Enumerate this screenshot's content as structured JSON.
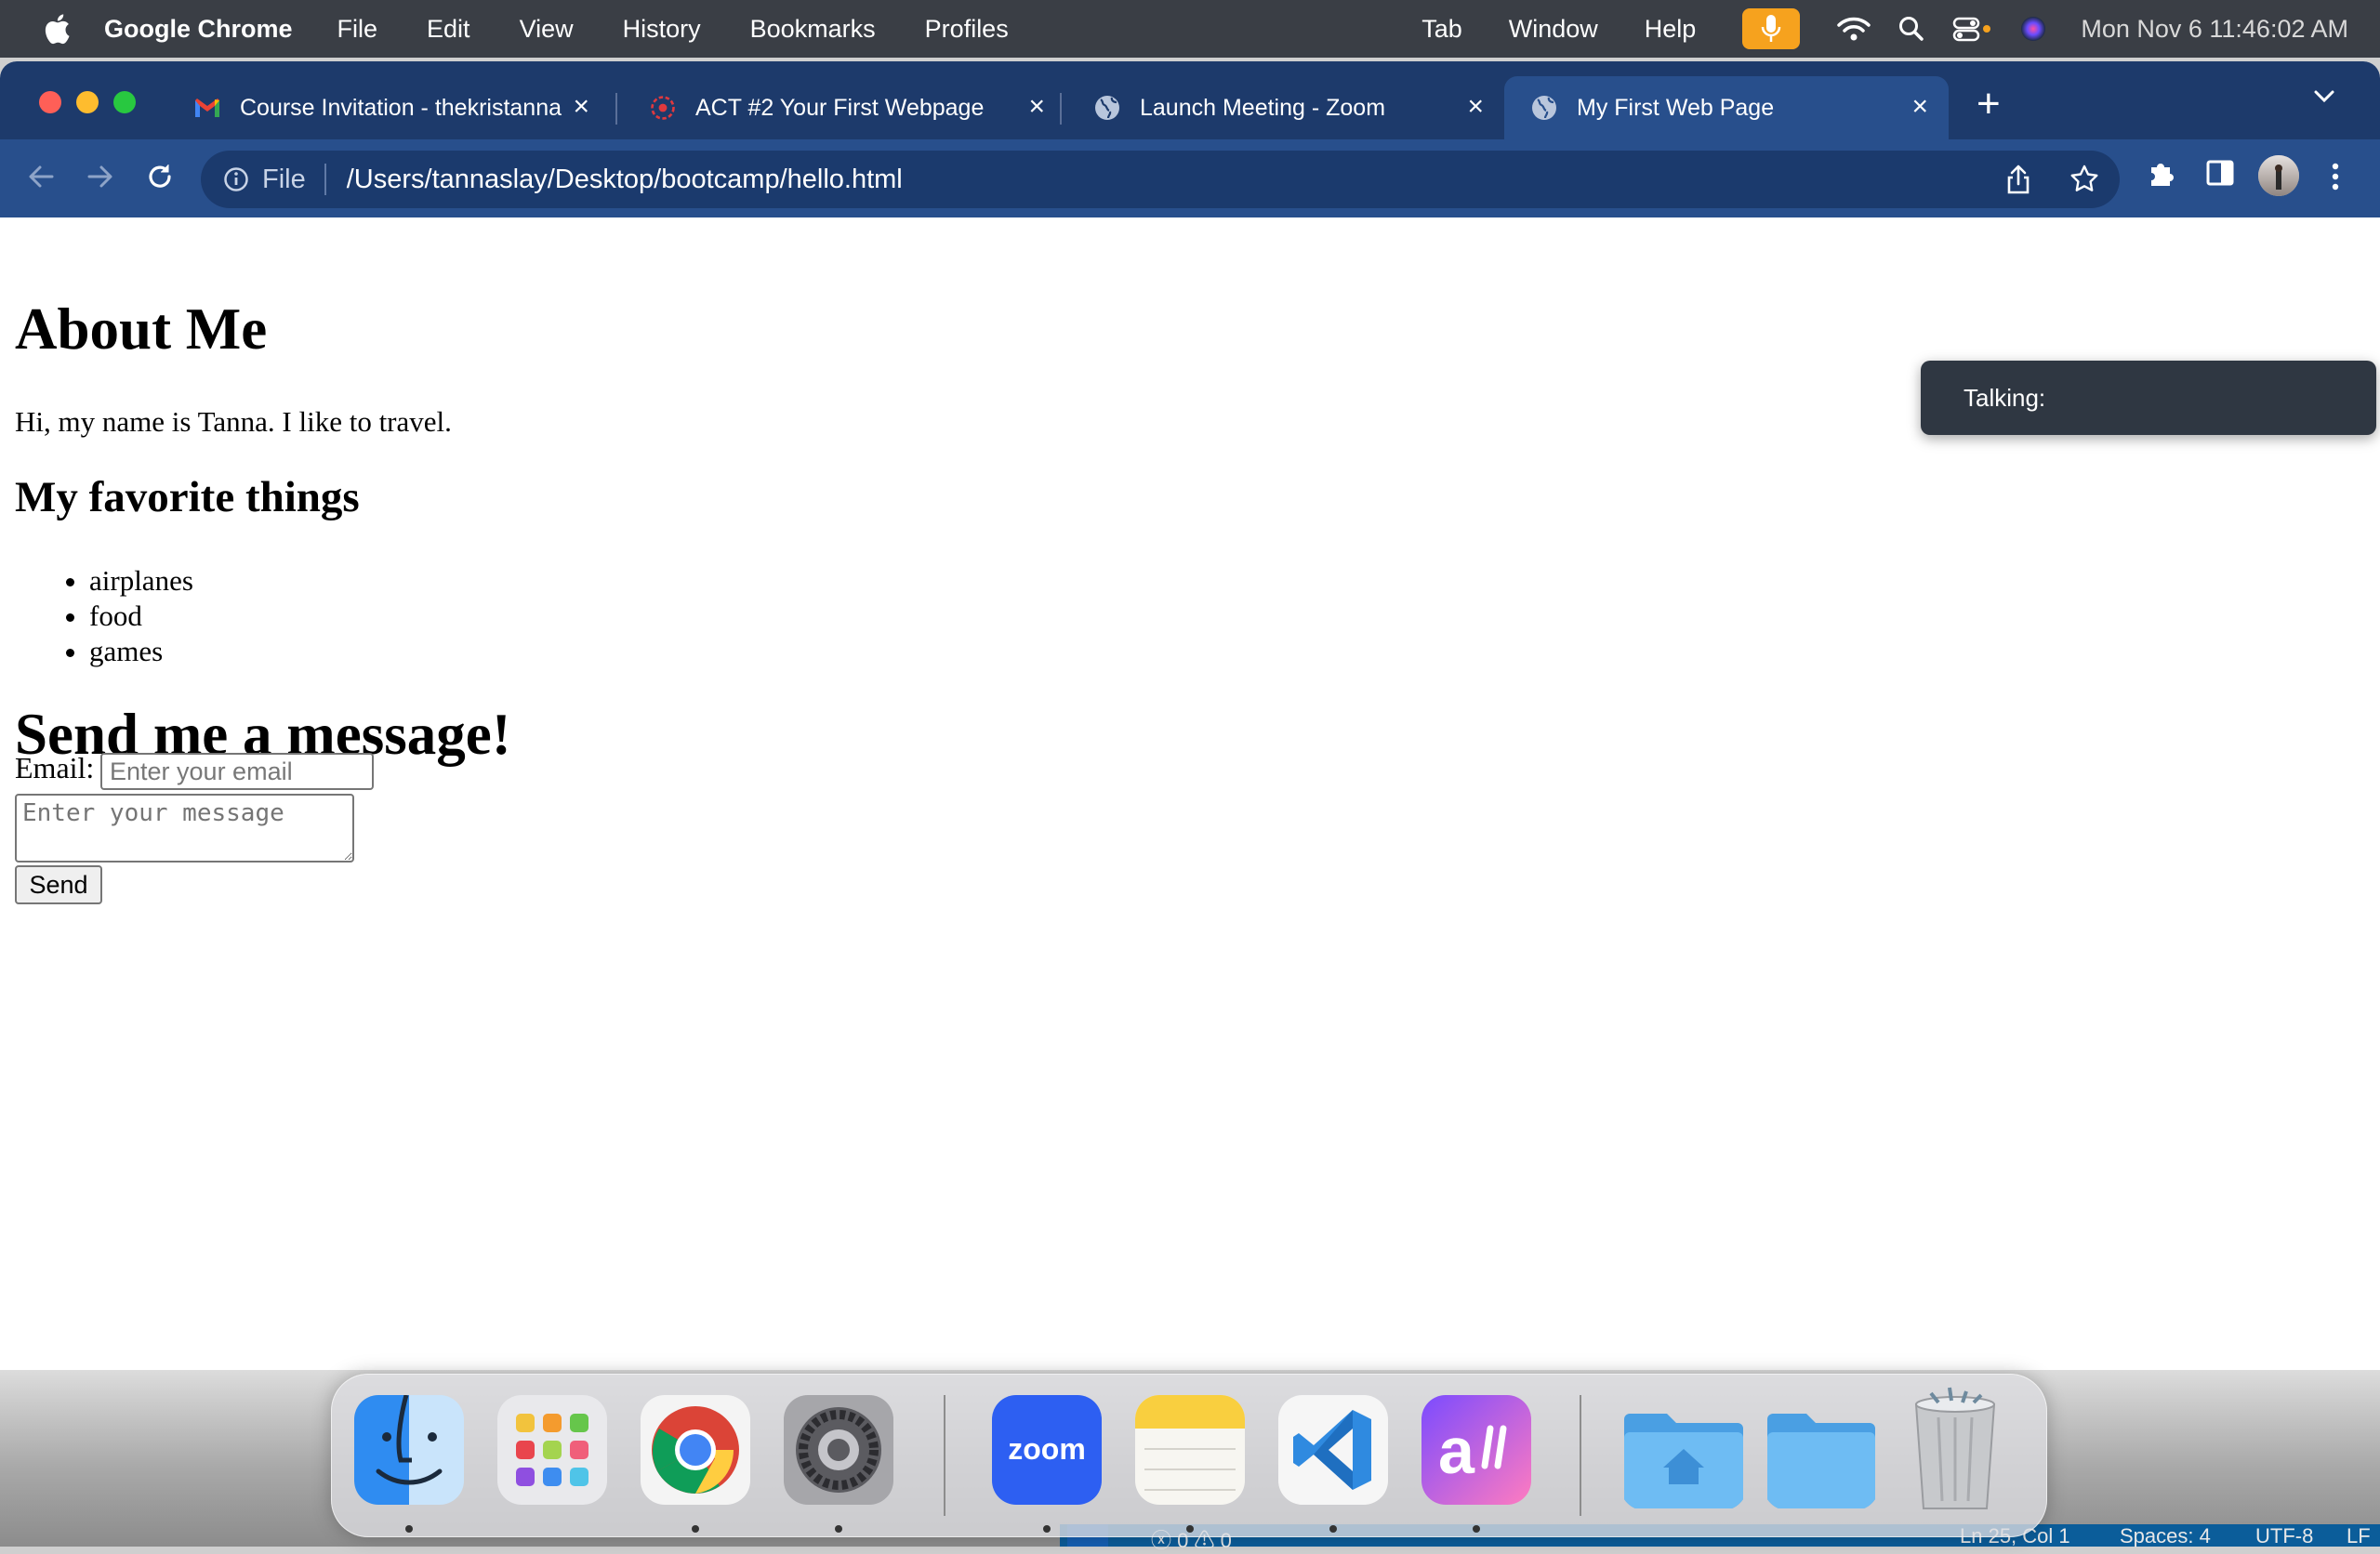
{
  "menubar": {
    "app_name": "Google Chrome",
    "menus": [
      "File",
      "Edit",
      "View",
      "History",
      "Bookmarks",
      "Profiles"
    ],
    "right_menus": [
      "Tab",
      "Window",
      "Help"
    ],
    "clock": "Mon Nov 6  11:46:02 AM"
  },
  "tabs": [
    {
      "title": "Course Invitation - thekristanna",
      "icon": "gmail-icon",
      "active": false
    },
    {
      "title": "ACT #2 Your First Webpage",
      "icon": "course-icon",
      "active": false
    },
    {
      "title": "Launch Meeting - Zoom",
      "icon": "globe-icon",
      "active": false
    },
    {
      "title": "My First Web Page",
      "icon": "globe-icon",
      "active": true
    }
  ],
  "omnibox": {
    "scheme": "File",
    "url": "/Users/tannaslay/Desktop/bootcamp/hello.html"
  },
  "page": {
    "heading": "About Me",
    "intro": "Hi, my name is Tanna. I like to travel.",
    "favorites_heading": "My favorite things",
    "favorites": [
      "airplanes",
      "food",
      "games"
    ],
    "message_heading": "Send me a message!",
    "email_label": "Email:",
    "email_placeholder": "Enter your email",
    "message_placeholder": "Enter your message",
    "send_label": "Send"
  },
  "zoom_overlay": {
    "label": "Talking:"
  },
  "dock": {
    "apps": [
      "Finder",
      "Launchpad",
      "Chrome",
      "System Settings",
      "Zoom",
      "Notes",
      "VS Code",
      "Alli",
      "Home Folder",
      "Folder",
      "Trash"
    ],
    "zoom_label": "zoom"
  },
  "vscode_status": {
    "problems": "ⓧ 0 ⚠ 0",
    "position": "Ln 25, Col 1",
    "spaces": "Spaces: 4",
    "encoding": "UTF-8",
    "eol": "LF"
  },
  "colors": {
    "menubar": "#3a3e45",
    "tabstrip": "#1d3a6b",
    "toolbar": "#284f8c",
    "mic": "#f6a21e"
  }
}
